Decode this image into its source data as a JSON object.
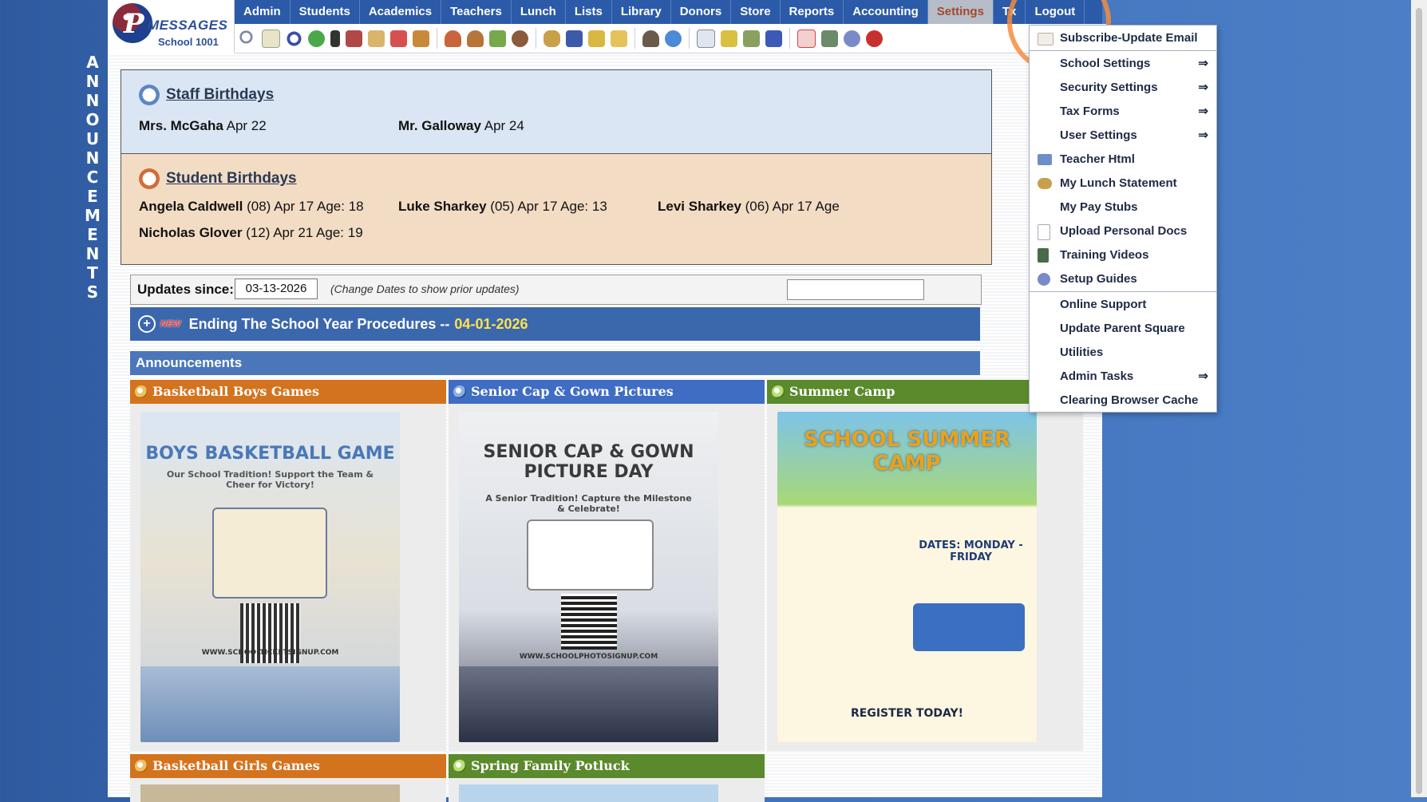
{
  "side_banner": {
    "letters": [
      "A",
      "N",
      "N",
      "O",
      "U",
      "N",
      "C",
      "E",
      "M",
      "E",
      "N",
      "T",
      "S"
    ]
  },
  "logo": {
    "brand": "MESSAGES",
    "school": "School 1001"
  },
  "nav": {
    "items": [
      "Admin",
      "Students",
      "Academics",
      "Teachers",
      "Lunch",
      "Lists",
      "Library",
      "Donors",
      "Store",
      "Reports",
      "Accounting",
      "Settings",
      "Tx",
      "Logout"
    ],
    "active": "Settings"
  },
  "toolbar": {
    "icons": [
      "search-icon",
      "calendar-grid-icon",
      "at-email-icon",
      "chat-icon",
      "phone-icon",
      "megaphone-icon",
      "report-icon",
      "calendar-icon",
      "announce-icon",
      "person-icon",
      "teacher-icon",
      "eraser-icon",
      "group-icon",
      "lunch-icon",
      "book-icon",
      "tag-icon",
      "mail-forward-icon",
      "staff-icon",
      "clock-icon",
      "grid-icon",
      "card-icon",
      "printer-icon",
      "ap-icon",
      "pdf-icon",
      "notebook-icon",
      "help-icon",
      "power-icon"
    ]
  },
  "staff_birthdays": {
    "title": "Staff Birthdays",
    "entries": [
      {
        "name": "Mrs. McGaha",
        "date": "Apr 22"
      },
      {
        "name": "Mr. Galloway",
        "date": "Apr 24"
      }
    ]
  },
  "student_birthdays": {
    "title": "Student Birthdays",
    "entries": [
      {
        "name": "Angela Caldwell",
        "detail": "(08) Apr 17 Age: 18"
      },
      {
        "name": "Luke Sharkey",
        "detail": "(05) Apr 17 Age: 13"
      },
      {
        "name": "Levi Sharkey",
        "detail": "(06) Apr 17 Age"
      },
      {
        "name": "Nicholas Glover",
        "detail": "(12) Apr 21 Age: 19"
      }
    ]
  },
  "updates": {
    "label": "Updates since:",
    "date": "03-13-2026",
    "hint": "(Change Dates to show prior updates)"
  },
  "banner": {
    "new_badge": "NEW",
    "title": "Ending The School Year Procedures --",
    "date": "04-01-2026"
  },
  "announcements": {
    "heading": "Announcements",
    "cards": [
      {
        "title": "Basketball Boys Games",
        "color": "#d4731e",
        "poster_title": "BOYS BASKETBALL GAME",
        "poster_sub": "Our School Tradition! Support the Team & Cheer for Victory!",
        "poster_footer": "WWW.SCHOOLTICKETSIGNUP.COM"
      },
      {
        "title": "Senior Cap & Gown Pictures",
        "color": "#3f6dc4",
        "poster_title": "SENIOR CAP & GOWN PICTURE DAY",
        "poster_sub": "A Senior Tradition! Capture the Milestone & Celebrate!",
        "poster_footer": "WWW.SCHOOLPHOTOSIGNUP.COM"
      },
      {
        "title": "Summer Camp",
        "color": "#5a8a2c",
        "poster_title": "SCHOOL SUMMER CAMP",
        "poster_sub": "DATES: MONDAY - FRIDAY",
        "poster_footer": "REGISTER TODAY!"
      },
      {
        "title": "Basketball Girls Games",
        "color": "#d4731e"
      },
      {
        "title": "Spring Family Potluck",
        "color": "#5a8a2c"
      }
    ]
  },
  "settings_menu": {
    "items": [
      {
        "label": "Subscribe-Update Email",
        "icon": "envelope-icon",
        "submenu": false
      },
      {
        "label": "School Settings",
        "icon": "",
        "submenu": true
      },
      {
        "label": "Security Settings",
        "icon": "",
        "submenu": true
      },
      {
        "label": "Tax Forms",
        "icon": "",
        "submenu": true
      },
      {
        "label": "User Settings",
        "icon": "",
        "submenu": true
      },
      {
        "label": "Teacher Html",
        "icon": "html-icon",
        "submenu": false
      },
      {
        "label": "My Lunch Statement",
        "icon": "lunch-icon",
        "submenu": false
      },
      {
        "label": "My Pay Stubs",
        "icon": "",
        "submenu": false
      },
      {
        "label": "Upload Personal Docs",
        "icon": "document-icon",
        "submenu": false
      },
      {
        "label": "Training Videos",
        "icon": "film-icon",
        "submenu": false
      },
      {
        "label": "Setup Guides",
        "icon": "help-icon",
        "submenu": false
      },
      {
        "label": "Online Support",
        "icon": "",
        "submenu": false
      },
      {
        "label": "Update Parent Square",
        "icon": "",
        "submenu": false
      },
      {
        "label": "Utilities",
        "icon": "",
        "submenu": false
      },
      {
        "label": "Admin Tasks",
        "icon": "",
        "submenu": true
      },
      {
        "label": "Clearing Browser Cache",
        "icon": "",
        "submenu": false
      }
    ],
    "arrow": "⇒"
  }
}
